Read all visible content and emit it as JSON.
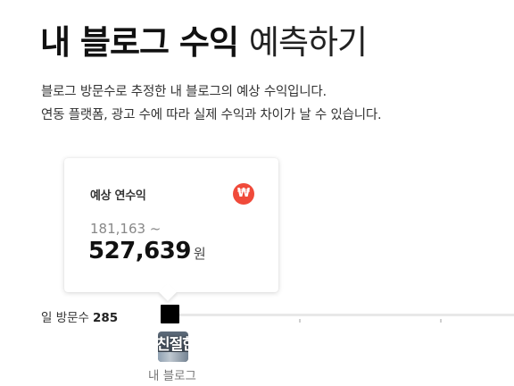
{
  "header": {
    "title_strong": "내 블로그 수익",
    "title_light": "예측하기",
    "description_lines": [
      "블로그 방문수로 추정한 내 블로그의 예상 수익입니다.",
      "연동 플랫폼, 광고 수에 따라 실제 수익과 차이가 날 수 있습니다."
    ]
  },
  "estimate_card": {
    "label": "예상 연수익",
    "currency_icon": "won-icon",
    "currency_symbol": "₩",
    "range_min": "181,163 ~",
    "range_max": "527,639",
    "currency_unit": "원"
  },
  "visits": {
    "label": "일 방문수",
    "value": "285"
  },
  "slider": {
    "position_fraction": 0.0
  },
  "blog": {
    "avatar_text": "친절한",
    "caption": "내 블로그"
  },
  "colors": {
    "accent": "#f04a3a",
    "handle": "#000000",
    "track": "#e8e8e8"
  }
}
